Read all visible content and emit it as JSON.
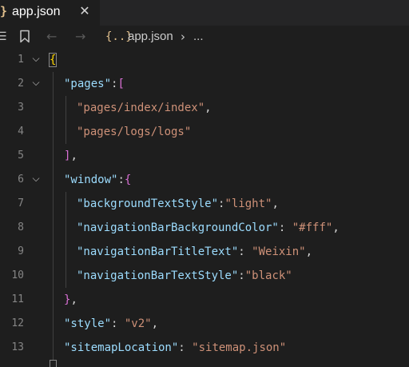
{
  "tab": {
    "icon_glyph": "}",
    "label": "app.json",
    "close_glyph": "✕"
  },
  "toolbar": {
    "menu_glyph": "☰",
    "back_glyph": "←",
    "forward_glyph": "→",
    "json_icon_glyph": "{..}",
    "breadcrumb_file": "app.json",
    "breadcrumb_sep": "›",
    "breadcrumb_more": "..."
  },
  "editor": {
    "lines": [
      {
        "num": "1",
        "fold": "⌵"
      },
      {
        "num": "2",
        "fold": "⌵"
      },
      {
        "num": "3"
      },
      {
        "num": "4"
      },
      {
        "num": "5"
      },
      {
        "num": "6",
        "fold": "⌵"
      },
      {
        "num": "7"
      },
      {
        "num": "8"
      },
      {
        "num": "9"
      },
      {
        "num": "10"
      },
      {
        "num": "11"
      },
      {
        "num": "12"
      },
      {
        "num": "13"
      }
    ],
    "tokens": {
      "l1_open": "{",
      "l2_key": "\"pages\"",
      "l2_colon": ":",
      "l2_open": "[",
      "l3_val": "\"pages/index/index\"",
      "l3_comma": ",",
      "l4_val": "\"pages/logs/logs\"",
      "l5_close": "]",
      "l5_comma": ",",
      "l6_key": "\"window\"",
      "l6_colon": ":",
      "l6_open": "{",
      "l7_key": "\"backgroundTextStyle\"",
      "l7_colon": ":",
      "l7_val": "\"light\"",
      "l7_comma": ",",
      "l8_key": "\"navigationBarBackgroundColor\"",
      "l8_colon": ": ",
      "l8_val": "\"#fff\"",
      "l8_comma": ",",
      "l9_key": "\"navigationBarTitleText\"",
      "l9_colon": ": ",
      "l9_val": "\"Weixin\"",
      "l9_comma": ",",
      "l10_key": "\"navigationBarTextStyle\"",
      "l10_colon": ":",
      "l10_val": "\"black\"",
      "l11_close": "}",
      "l11_comma": ",",
      "l12_key": "\"style\"",
      "l12_colon": ": ",
      "l12_val": "\"v2\"",
      "l12_comma": ",",
      "l13_key": "\"sitemapLocation\"",
      "l13_colon": ": ",
      "l13_val": "\"sitemap.json\""
    }
  },
  "colors": {
    "background": "#1e1e1e",
    "tabbar": "#252526",
    "key": "#9cdcfe",
    "string": "#ce9178",
    "bracket_level1": "#ffd700",
    "bracket_level2": "#da70d6",
    "bracket_level3": "#179fff",
    "line_number": "#858585",
    "json_icon": "#e2c08d"
  }
}
